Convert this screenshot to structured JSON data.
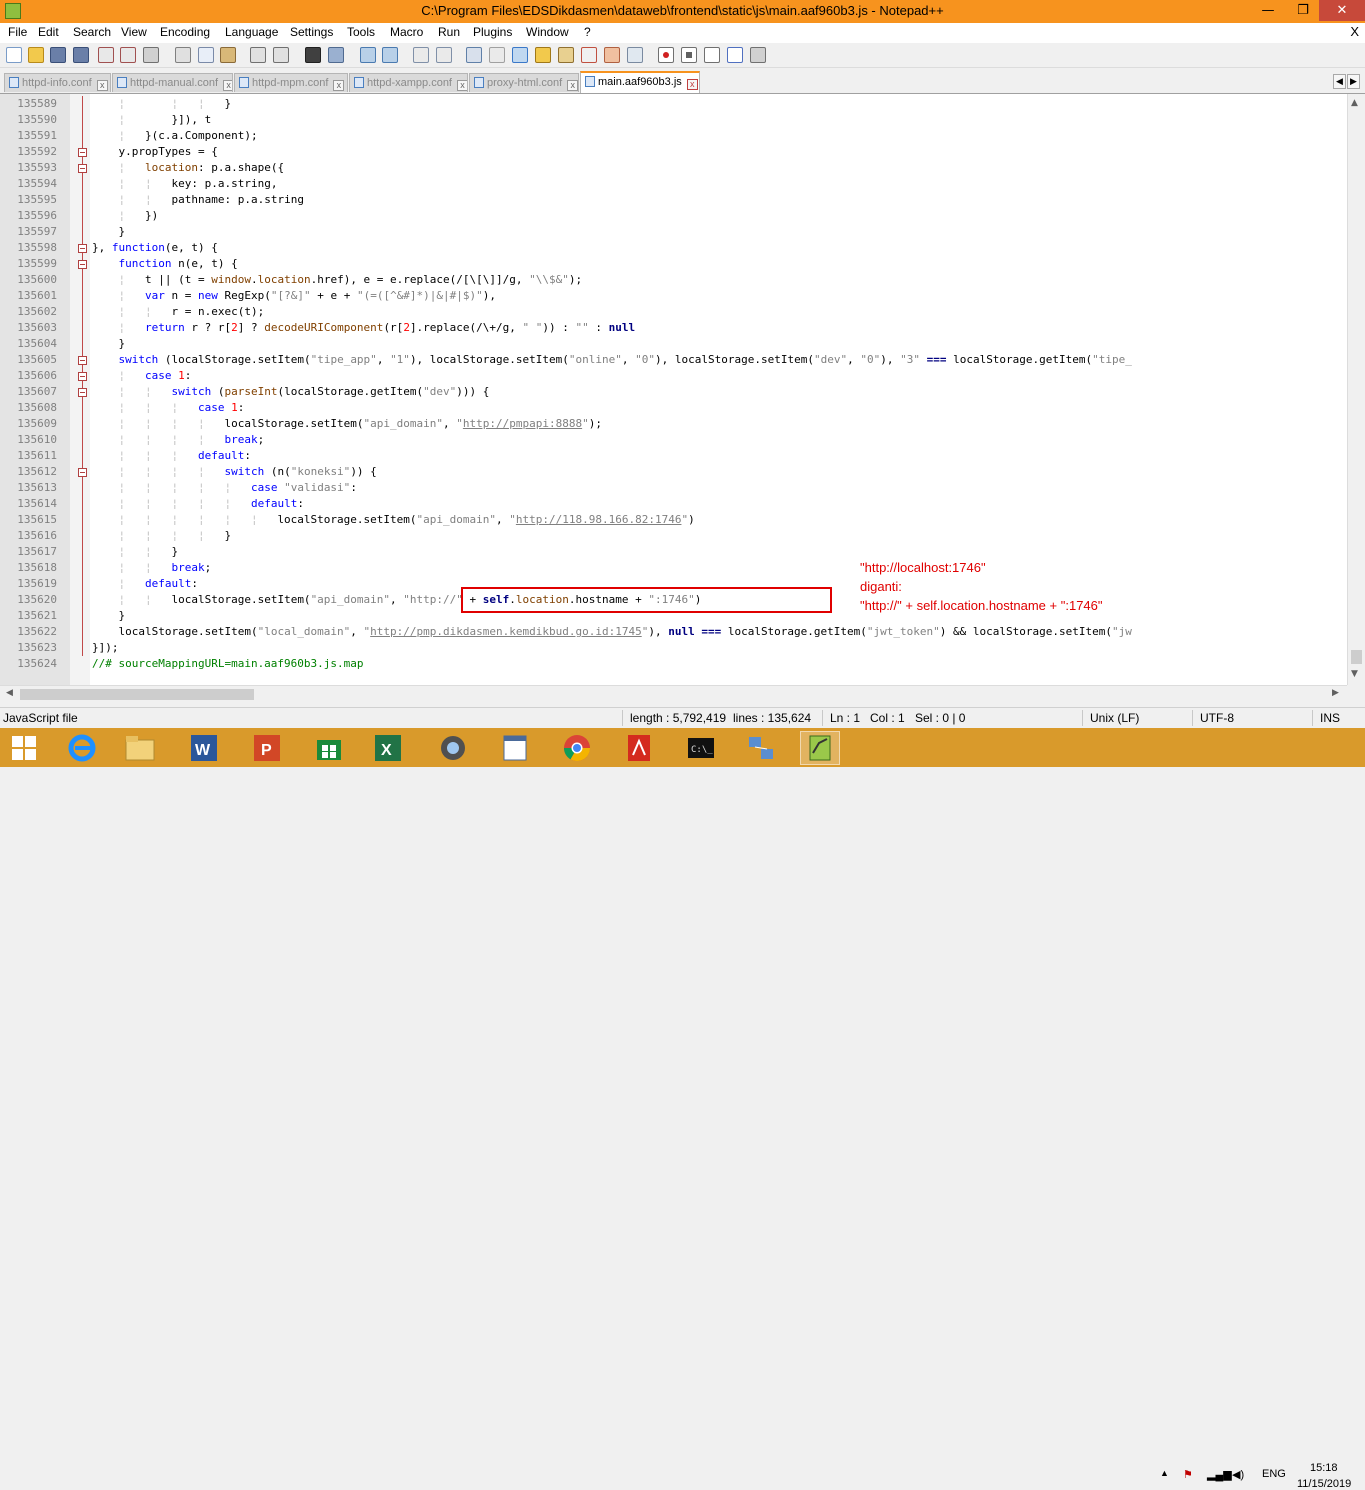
{
  "window": {
    "title": "C:\\Program Files\\EDSDikdasmen\\dataweb\\frontend\\static\\js\\main.aaf960b3.js - Notepad++",
    "minimize": "—",
    "maximize": "❐",
    "close": "✕"
  },
  "menu": {
    "items": [
      "File",
      "Edit",
      "Search",
      "View",
      "Encoding",
      "Language",
      "Settings",
      "Tools",
      "Macro",
      "Run",
      "Plugins",
      "Window",
      "?"
    ],
    "close": "X"
  },
  "toolbar": {
    "icons": [
      "new-file-icon",
      "open-file-icon",
      "save-icon",
      "save-all-icon",
      "close-icon",
      "close-all-icon",
      "print-icon",
      "cut-icon",
      "copy-icon",
      "paste-icon",
      "undo-icon",
      "redo-icon",
      "find-icon",
      "replace-icon",
      "zoom-in-icon",
      "zoom-out-icon",
      "sync-vertical-icon",
      "sync-horizontal-icon",
      "word-wrap-icon",
      "show-all-chars-icon",
      "indent-guide-icon",
      "user-language-icon",
      "doc-map-icon",
      "function-list-icon",
      "folder-workspace-icon",
      "monitoring-icon",
      "record-macro-icon",
      "stop-record-icon",
      "play-macro-icon",
      "run-macro-multiple-icon",
      "save-macro-icon"
    ]
  },
  "tabs": [
    {
      "label": "httpd-info.conf",
      "active": false
    },
    {
      "label": "httpd-manual.conf",
      "active": false
    },
    {
      "label": "httpd-mpm.conf",
      "active": false
    },
    {
      "label": "httpd-xampp.conf",
      "active": false
    },
    {
      "label": "proxy-html.conf",
      "active": false
    },
    {
      "label": "main.aaf960b3.js",
      "active": true
    }
  ],
  "tabnav": {
    "left": "◀",
    "right": "▶"
  },
  "editor": {
    "line_numbers": [
      "135589",
      "135590",
      "135591",
      "135592",
      "135593",
      "135594",
      "135595",
      "135596",
      "135597",
      "135598",
      "135599",
      "135600",
      "135601",
      "135602",
      "135603",
      "135604",
      "135605",
      "135606",
      "135607",
      "135608",
      "135609",
      "135610",
      "135611",
      "135612",
      "135613",
      "135614",
      "135615",
      "135616",
      "135617",
      "135618",
      "135619",
      "135620",
      "135621",
      "135622",
      "135623",
      "135624"
    ],
    "code_text": {
      "l135601_regex": "\"[?&]\"",
      "l135601_regex2": "\"(=([^&#]*)|&|#|$)\"",
      "l135600_str": "\"\\\\$&\"",
      "l135605_tipe_app": "\"tipe_app\"",
      "l135622_url": "http://pmp.dikdasmen.kemdikbud.go.id:1745",
      "l135609_url": "http://pmpapi:8888",
      "l135615_url": "http://118.98.166.82:1746",
      "l135620_port": "\":1746\"",
      "l135624_comment": "//# sourceMappingURL=main.aaf960b3.js.map"
    }
  },
  "annotation": {
    "line1": "\"http://localhost:1746\"",
    "line2": "diganti:",
    "line3": "\"http://\" + self.location.hostname + \":1746\""
  },
  "statusbar": {
    "filetype": "JavaScript file",
    "length": "length : 5,792,419",
    "lines": "lines : 135,624",
    "ln": "Ln : 1",
    "col": "Col : 1",
    "sel": "Sel : 0 | 0",
    "eol": "Unix (LF)",
    "encoding": "UTF-8",
    "mode": "INS"
  },
  "taskbar": {
    "apps": [
      "windows-start-icon",
      "internet-explorer-icon",
      "file-explorer-icon",
      "word-icon",
      "powerpoint-icon",
      "store-icon",
      "excel-icon",
      "camera-icon",
      "notepad-doc-icon",
      "chrome-icon",
      "acrobat-icon",
      "cmd-icon",
      "network-icon",
      "notepadpp-icon"
    ],
    "language": "ENG",
    "time": "15:18",
    "date": "11/15/2019"
  },
  "colors": {
    "title_bar": "#f7931e",
    "taskbar": "#d99a2b",
    "highlight": "#e00000",
    "keyword": "#0000ff",
    "string": "#808080",
    "number": "#ff0000"
  }
}
